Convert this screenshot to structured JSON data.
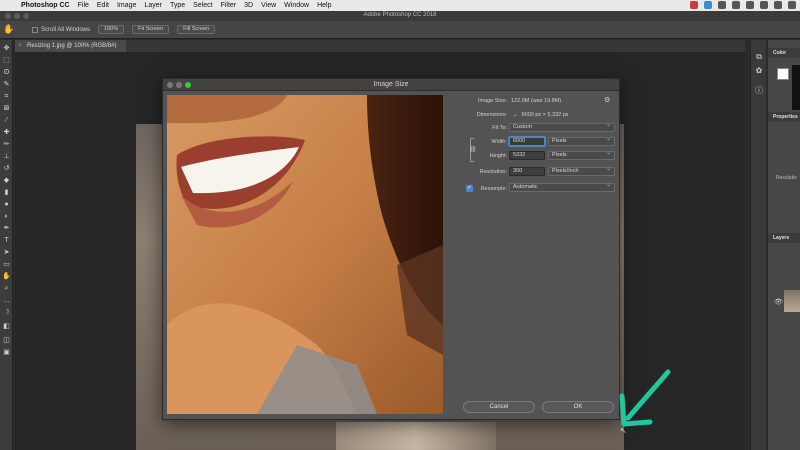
{
  "menubar": {
    "app_name": "Photoshop CC",
    "items": [
      "File",
      "Edit",
      "Image",
      "Layer",
      "Type",
      "Select",
      "Filter",
      "3D",
      "View",
      "Window",
      "Help"
    ]
  },
  "app_title": "Adobe Photoshop CC 2018",
  "options_bar": {
    "scroll_all_windows": "Scroll All Windows",
    "zoom_100": "100%",
    "fit_screen": "Fit Screen",
    "fill_screen": "Fill Screen"
  },
  "document_tab": "Resizing 1.jpg @ 100% (RGB/8#)",
  "panels": {
    "color": "Color",
    "properties": "Properties",
    "layers": "Layers",
    "res_text": "Resolutio"
  },
  "dialog": {
    "title": "Image Size",
    "image_size_label": "Image Size:",
    "image_size_value": "122.0M (was 19.8M)",
    "dimensions_label": "Dimensions:",
    "dimensions_value": "6000 px × 5,332 px",
    "fit_to_label": "Fit To:",
    "fit_to_value": "Custom",
    "width_label": "Width:",
    "width_value": "6000",
    "width_unit": "Pixels",
    "height_label": "Height:",
    "height_value": "5332",
    "height_unit": "Pixels",
    "resolution_label": "Resolution:",
    "resolution_value": "300",
    "resolution_unit": "Pixels/Inch",
    "resample_label": "Resample:",
    "resample_value": "Automatic",
    "cancel": "Cancel",
    "ok": "OK"
  },
  "colors": {
    "accent_arrow": "#1ec9a0",
    "focus": "#4d83c7"
  }
}
